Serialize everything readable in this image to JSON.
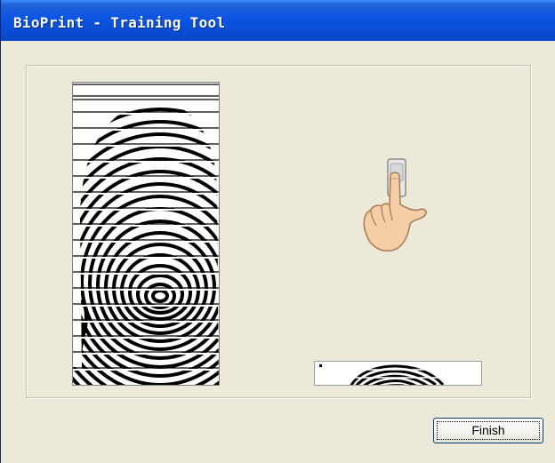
{
  "window": {
    "title": "BioPrint - Training Tool"
  },
  "main": {
    "scan_panel": {
      "icon": "fingerprint-scan"
    },
    "guide": {
      "icon": "hand-pointing-on-sensor-icon"
    },
    "preview_panel": {
      "icon": "fingerprint-partial-preview"
    }
  },
  "footer": {
    "finish_label": "Finish"
  },
  "colors": {
    "title_bar": "#0a4fd6",
    "window_bg": "#ece9d8",
    "button_border": "#003c74",
    "skin": "#f4cfa8"
  }
}
